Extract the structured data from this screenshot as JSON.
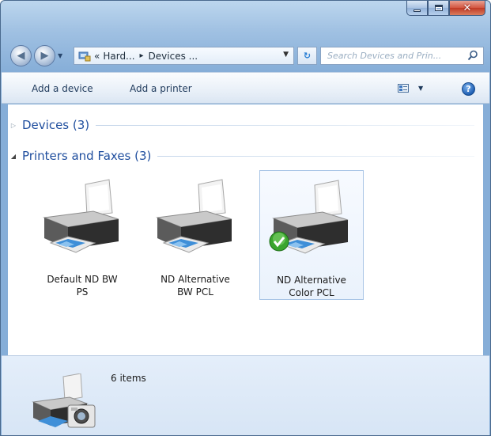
{
  "window": {
    "caption_buttons": {
      "minimize": "minimize",
      "maximize": "maximize",
      "close": "close"
    }
  },
  "nav": {
    "address_parts": [
      "«",
      "Hard...",
      "▸",
      "Devices ..."
    ],
    "search_placeholder": "Search Devices and Prin..."
  },
  "command_bar": {
    "add_device": "Add a device",
    "add_printer": "Add a printer",
    "help_glyph": "?"
  },
  "groups": {
    "devices": {
      "label": "Devices (3)",
      "expanded": false
    },
    "printers": {
      "label": "Printers and Faxes (3)",
      "expanded": true
    }
  },
  "printers": [
    {
      "label_line1": "Default ND BW",
      "label_line2": "PS",
      "default": false,
      "selected": false
    },
    {
      "label_line1": "ND Alternative",
      "label_line2": "BW PCL",
      "default": false,
      "selected": false
    },
    {
      "label_line1": "ND Alternative",
      "label_line2": "Color PCL",
      "default": true,
      "selected": true
    }
  ],
  "details": {
    "item_count": "6 items"
  },
  "colors": {
    "accent": "#1f4e9e",
    "default_check": "#3aa52e",
    "selection_border": "#a9c5e6"
  }
}
